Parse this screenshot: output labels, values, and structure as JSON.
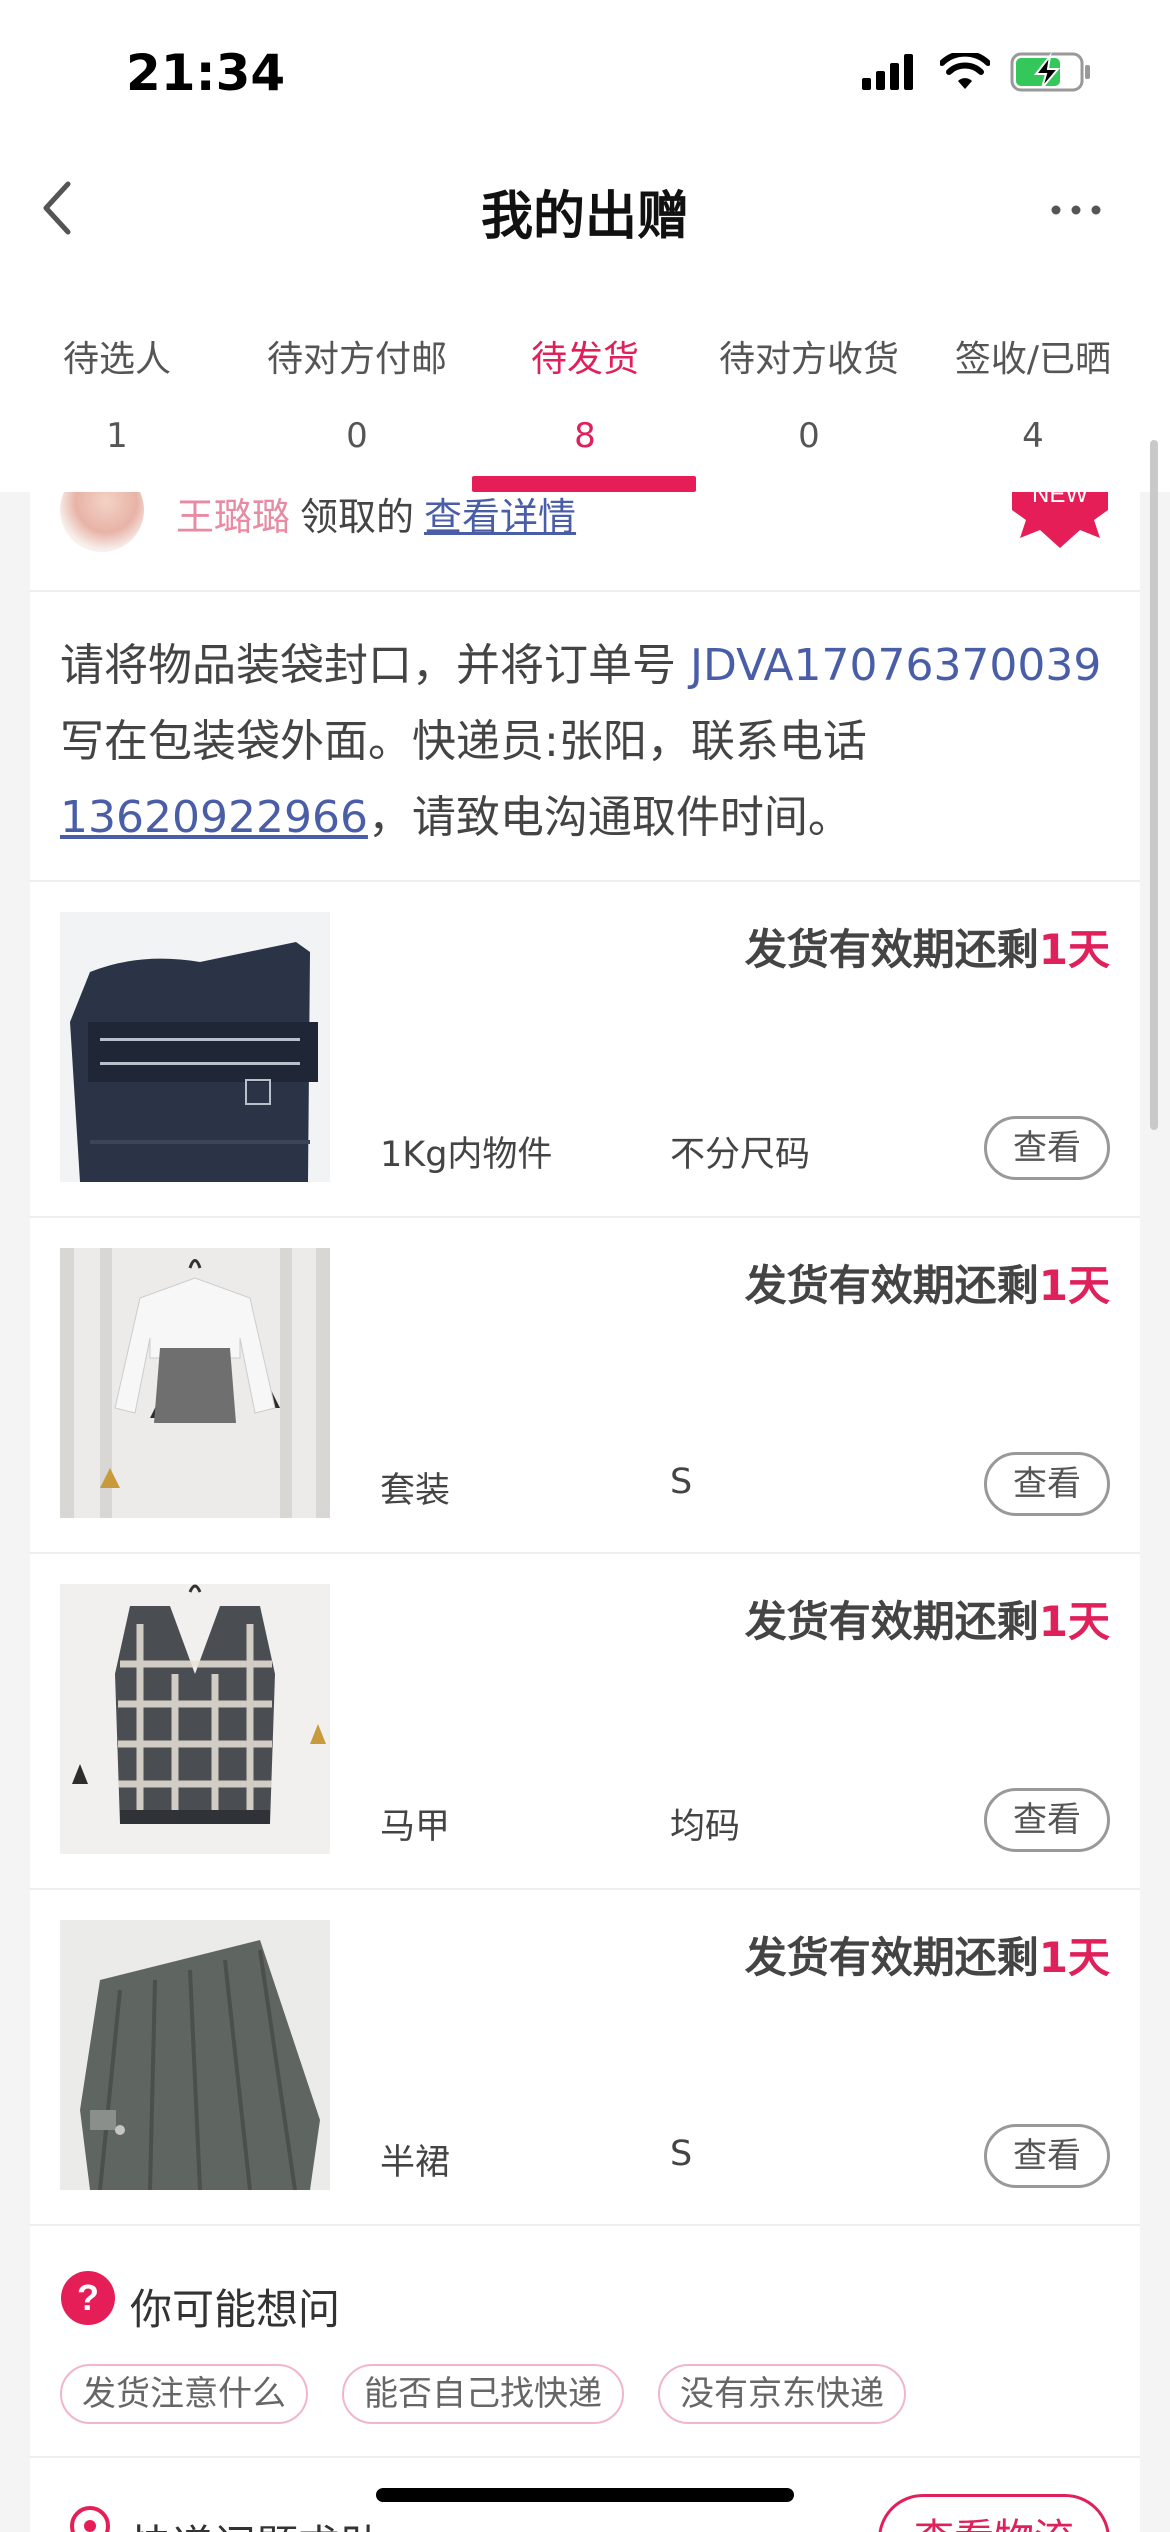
{
  "status_bar": {
    "time": "21:34"
  },
  "nav": {
    "title": "我的出赠"
  },
  "tabs": [
    {
      "label": "待选人",
      "count": "1"
    },
    {
      "label": "待对方付邮",
      "count": "0"
    },
    {
      "label": "待发货",
      "count": "8"
    },
    {
      "label": "待对方收货",
      "count": "0"
    },
    {
      "label": "签收/已晒",
      "count": "4"
    }
  ],
  "active_tab_index": 2,
  "order": {
    "recipient_name": "王璐璐",
    "taken_text": "领取的",
    "detail_link": "查看详情",
    "new_badge": "NEW",
    "notice": {
      "part1": "请将物品装袋封口，并将订单号 ",
      "order_number": "JDVA17076370039",
      "part2": " 写在包装袋外面。快递员:张阳，联系电话",
      "phone": "13620922966",
      "part3": "，请致电沟通取件时间。"
    }
  },
  "items": [
    {
      "deadline_prefix": "发货有效期还剩",
      "deadline_value": "1天",
      "name": "1Kg内物件",
      "size": "不分尺码",
      "view_label": "查看",
      "thumb_icon": "waist-trainer-photo"
    },
    {
      "deadline_prefix": "发货有效期还剩",
      "deadline_value": "1天",
      "name": "套装",
      "size": "S",
      "view_label": "查看",
      "thumb_icon": "cardigan-set-photo"
    },
    {
      "deadline_prefix": "发货有效期还剩",
      "deadline_value": "1天",
      "name": "马甲",
      "size": "均码",
      "view_label": "查看",
      "thumb_icon": "plaid-vest-photo"
    },
    {
      "deadline_prefix": "发货有效期还剩",
      "deadline_value": "1天",
      "name": "半裙",
      "size": "S",
      "view_label": "查看",
      "thumb_icon": "pleated-skirt-photo"
    }
  ],
  "faq": {
    "title": "你可能想问",
    "chips": [
      "发货注意什么",
      "能否自己找快递",
      "没有京东快递"
    ]
  },
  "help": {
    "label": "快递问题求助",
    "button": "查看物流"
  },
  "colors": {
    "accent": "#e0205a",
    "link": "#4a5ea8",
    "badge": "#e61e57"
  }
}
